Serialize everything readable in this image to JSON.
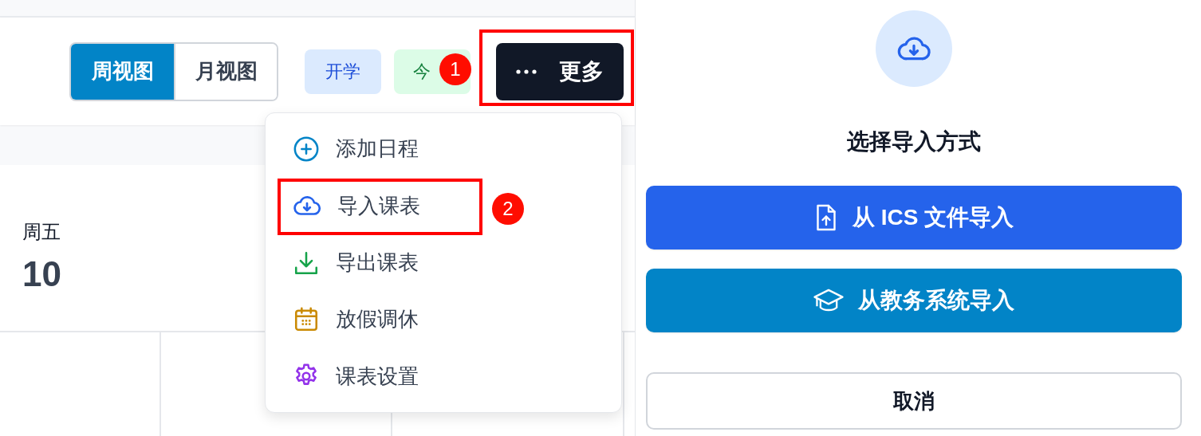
{
  "calendar": {
    "view_tabs": [
      {
        "label": "周视图",
        "selected": true
      },
      {
        "label": "月视图",
        "selected": false
      }
    ],
    "chips": [
      {
        "label": "开学",
        "kind": "term"
      },
      {
        "label": "今",
        "kind": "today"
      }
    ],
    "more_button": {
      "label": "更多"
    },
    "days": [
      {
        "weekday": "周五",
        "date": "10"
      }
    ],
    "menu": [
      {
        "label": "添加日程",
        "kind": "add"
      },
      {
        "label": "导入课表",
        "kind": "import"
      },
      {
        "label": "导出课表",
        "kind": "export"
      },
      {
        "label": "放假调休",
        "kind": "holiday"
      },
      {
        "label": "课表设置",
        "kind": "settings"
      }
    ]
  },
  "annotations": [
    {
      "label": "1"
    },
    {
      "label": "2"
    }
  ],
  "dialog": {
    "title": "选择导入方式",
    "options": [
      {
        "label": "从 ICS 文件导入",
        "kind": "file"
      },
      {
        "label": "从教务系统导入",
        "kind": "system"
      }
    ],
    "cancel": "取消"
  }
}
